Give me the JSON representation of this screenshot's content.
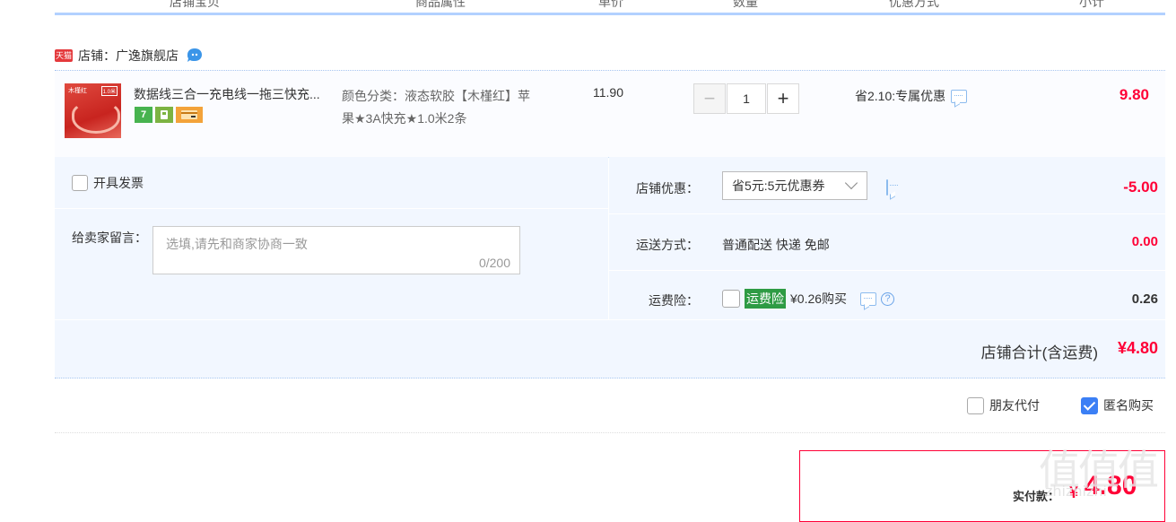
{
  "header": {
    "columns": [
      "店铺宝贝",
      "商品属性",
      "单价",
      "数量",
      "优惠方式",
      "小计"
    ]
  },
  "shop": {
    "badge": "天猫",
    "label": "店铺：广逸旗舰店"
  },
  "item": {
    "thumb_text": "木槿红",
    "thumb_tag": "1.0米",
    "title": "数据线三合一充电线一拖三快充...",
    "badge_seven": "7",
    "props_line1": "颜色分类：液态软胶【木槿红】苹",
    "props_line2": "果★3A快充★1.0米2条",
    "unit_price": "11.90",
    "quantity": "1",
    "minus": "−",
    "plus": "+",
    "discount": "省2.10:专属优惠",
    "subtotal": "9.80"
  },
  "options": {
    "invoice_label": "开具发票",
    "message_label": "给卖家留言：",
    "message_placeholder": "选填,请先和商家协商一致",
    "message_count": "0/200",
    "shop_discount_label": "店铺优惠：",
    "shop_discount_value": "省5元:5元优惠券",
    "shop_discount_amount": "-5.00",
    "shipping_label": "运送方式：",
    "shipping_value": "普通配送 快递 免邮",
    "shipping_amount": "0.00",
    "insurance_label": "运费险：",
    "insurance_tag": "运费险",
    "insurance_price": "¥0.26购买",
    "insurance_help": "?",
    "insurance_amount": "0.26"
  },
  "total": {
    "label": "店铺合计(含运费)",
    "amount": "¥4.80"
  },
  "extra": {
    "friend_pay": "朋友代付",
    "anonymous": "匿名购买",
    "anonymous_checked": true
  },
  "pay": {
    "label": "实付款：",
    "currency": "¥",
    "amount": "4.80"
  },
  "watermark": {
    "text": "值值值",
    "sub": "zhizhizhi"
  },
  "colors": {
    "accent_red": "#ff0036",
    "light_blue_bg": "#f2f7ff",
    "checkbox_blue": "#3b7ff5",
    "insurance_green": "#2e9b44"
  }
}
